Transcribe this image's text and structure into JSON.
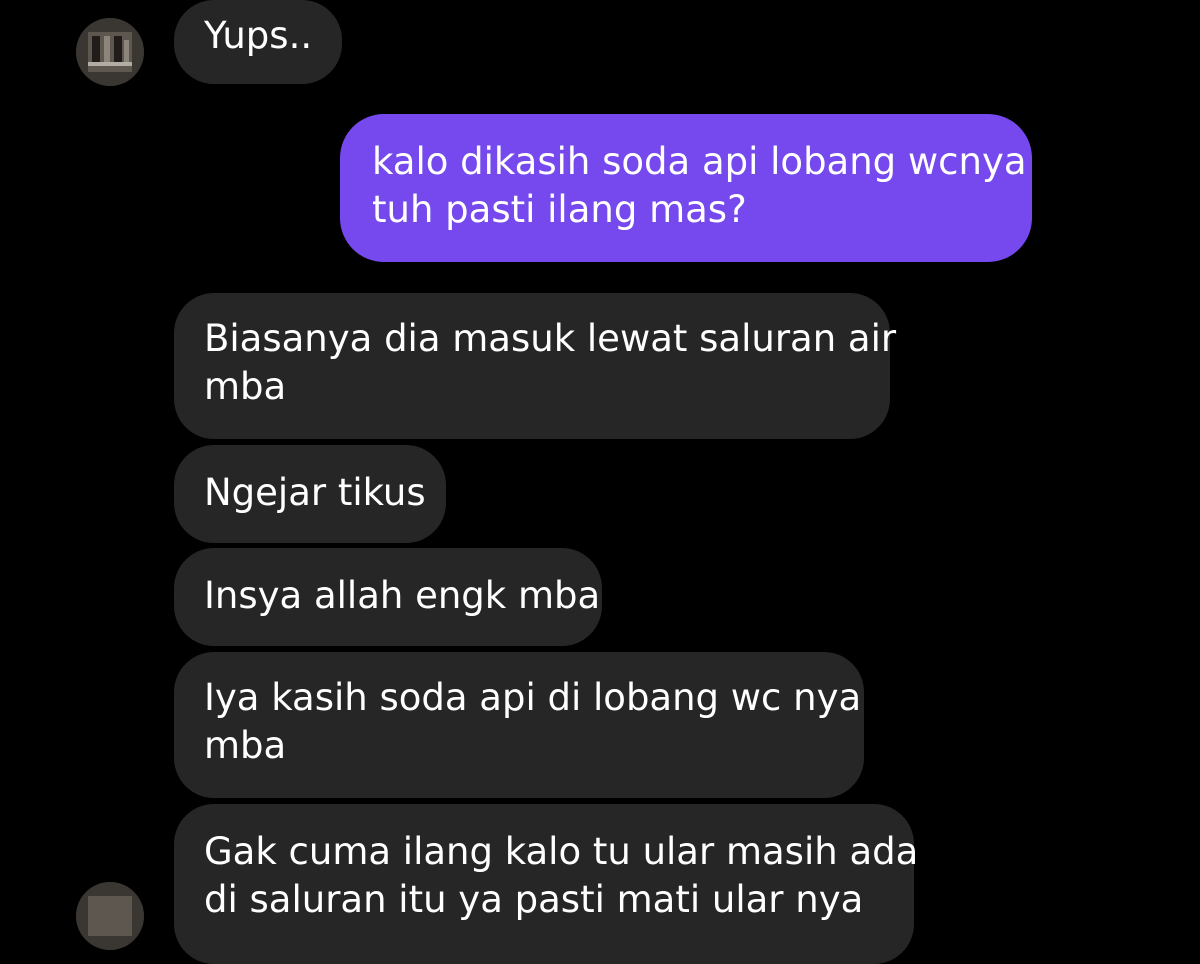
{
  "conversation": {
    "messages": [
      {
        "direction": "incoming",
        "lines": [
          "Yups.."
        ]
      },
      {
        "direction": "outgoing",
        "lines": [
          "kalo dikasih soda api lobang wcnya",
          "tuh pasti ilang mas?"
        ]
      },
      {
        "direction": "incoming",
        "lines": [
          "Biasanya dia masuk lewat saluran air",
          "mba"
        ]
      },
      {
        "direction": "incoming",
        "lines": [
          "Ngejar tikus"
        ]
      },
      {
        "direction": "incoming",
        "lines": [
          "Insya allah engk mba"
        ]
      },
      {
        "direction": "incoming",
        "lines": [
          "Iya kasih soda api di lobang wc nya",
          "mba"
        ]
      },
      {
        "direction": "incoming",
        "lines": [
          "Gak cuma ilang kalo tu ular masih ada",
          "di saluran itu ya pasti mati ular nya"
        ]
      }
    ]
  },
  "colors": {
    "background": "#000000",
    "incoming_bubble": "#262626",
    "outgoing_bubble": "#7549ee",
    "text": "#ffffff"
  }
}
